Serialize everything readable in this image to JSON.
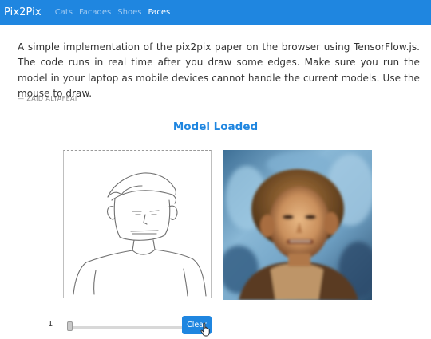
{
  "navbar": {
    "brand": "Pix2Pix",
    "items": [
      {
        "label": "Cats",
        "active": false
      },
      {
        "label": "Facades",
        "active": false
      },
      {
        "label": "Shoes",
        "active": false
      },
      {
        "label": "Faces",
        "active": true
      }
    ]
  },
  "intro": {
    "text": "A simple implementation of the pix2pix paper on the browser using TensorFlow.js. The code runs in real time after you draw some edges. Make sure you run the model in your laptop as mobile devices cannot handle the current models. Use the mouse to draw.",
    "author": "— ZAID ALYAFEAI"
  },
  "status": "Model Loaded",
  "controls": {
    "slider_value": "1",
    "slider_fraction": 0,
    "clear_label": "Clear"
  },
  "icons": {
    "cursor": "hand-pointer-icon"
  },
  "colors": {
    "accent": "#1f86e0",
    "nav_inactive": "#9fcaf2"
  }
}
